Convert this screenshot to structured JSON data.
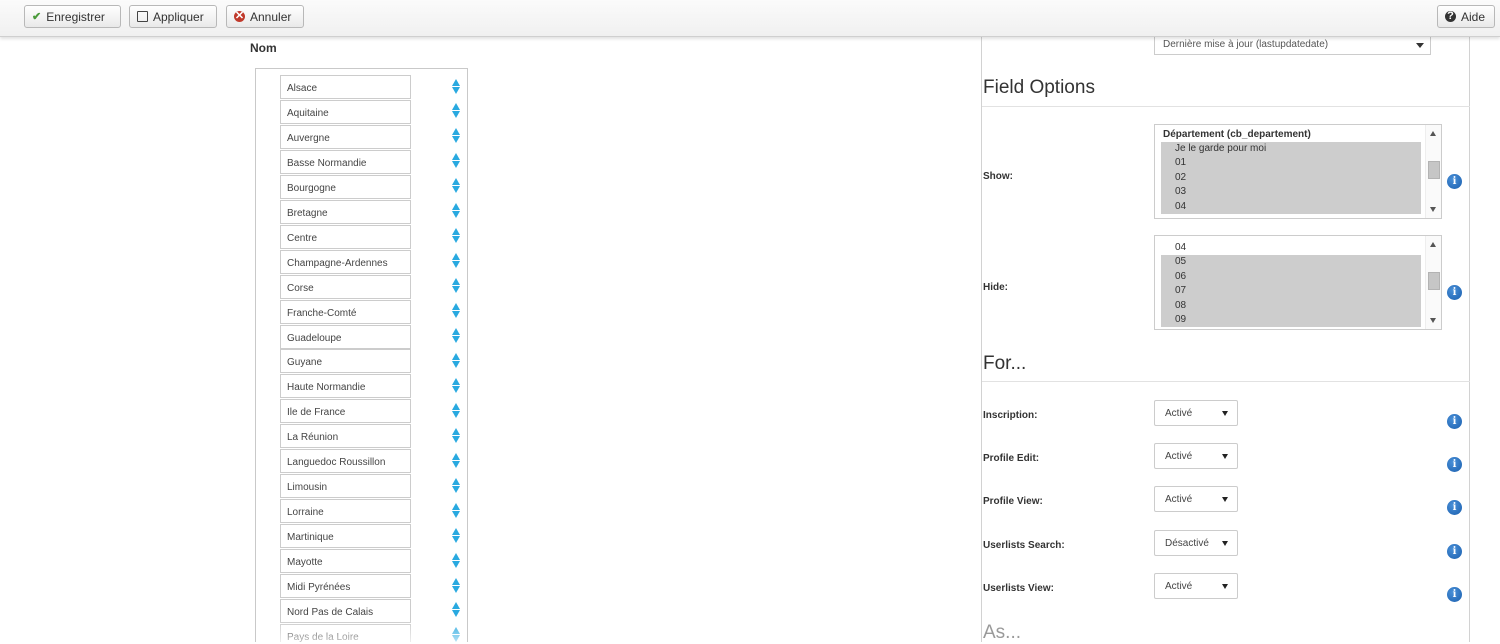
{
  "toolbar": {
    "save_label": "Enregistrer",
    "apply_label": "Appliquer",
    "cancel_label": "Annuler",
    "help_label": "Aide"
  },
  "list": {
    "title": "Nom",
    "items": [
      "Alsace",
      "Aquitaine",
      "Auvergne",
      "Basse Normandie",
      "Bourgogne",
      "Bretagne",
      "Centre",
      "Champagne-Ardennes",
      "Corse",
      "Franche-Comté",
      "Guadeloupe",
      "Guyane",
      "Haute Normandie",
      "Ile de France",
      "La Réunion",
      "Languedoc Roussillon",
      "Limousin",
      "Lorraine",
      "Martinique",
      "Mayotte",
      "Midi Pyrénées",
      "Nord Pas de Calais",
      "Pays de la Loire"
    ]
  },
  "right": {
    "sort_select_value": "Dernière mise à jour (lastupdatedate)",
    "field_options": {
      "title": "Field Options",
      "show": {
        "label": "Show:",
        "group": "Département (cb_departement)",
        "options": [
          "Je le garde pour moi",
          "01",
          "02",
          "03",
          "04"
        ]
      },
      "hide": {
        "label": "Hide:",
        "options": [
          "04",
          "05",
          "06",
          "07",
          "08",
          "09"
        ]
      }
    },
    "for": {
      "title": "For...",
      "rows": [
        {
          "label": "Inscription:",
          "value": "Activé"
        },
        {
          "label": "Profile Edit:",
          "value": "Activé"
        },
        {
          "label": "Profile View:",
          "value": "Activé"
        },
        {
          "label": "Userlists Search:",
          "value": "Désactivé"
        },
        {
          "label": "Userlists View:",
          "value": "Activé"
        }
      ]
    },
    "as_title": "As..."
  },
  "colors": {
    "accent_blue": "#29a9e0",
    "info_blue": "#1a5fae",
    "selection_gray": "#cdcdcd",
    "save_green": "#4a9a3a",
    "cancel_red": "#c0392b"
  }
}
